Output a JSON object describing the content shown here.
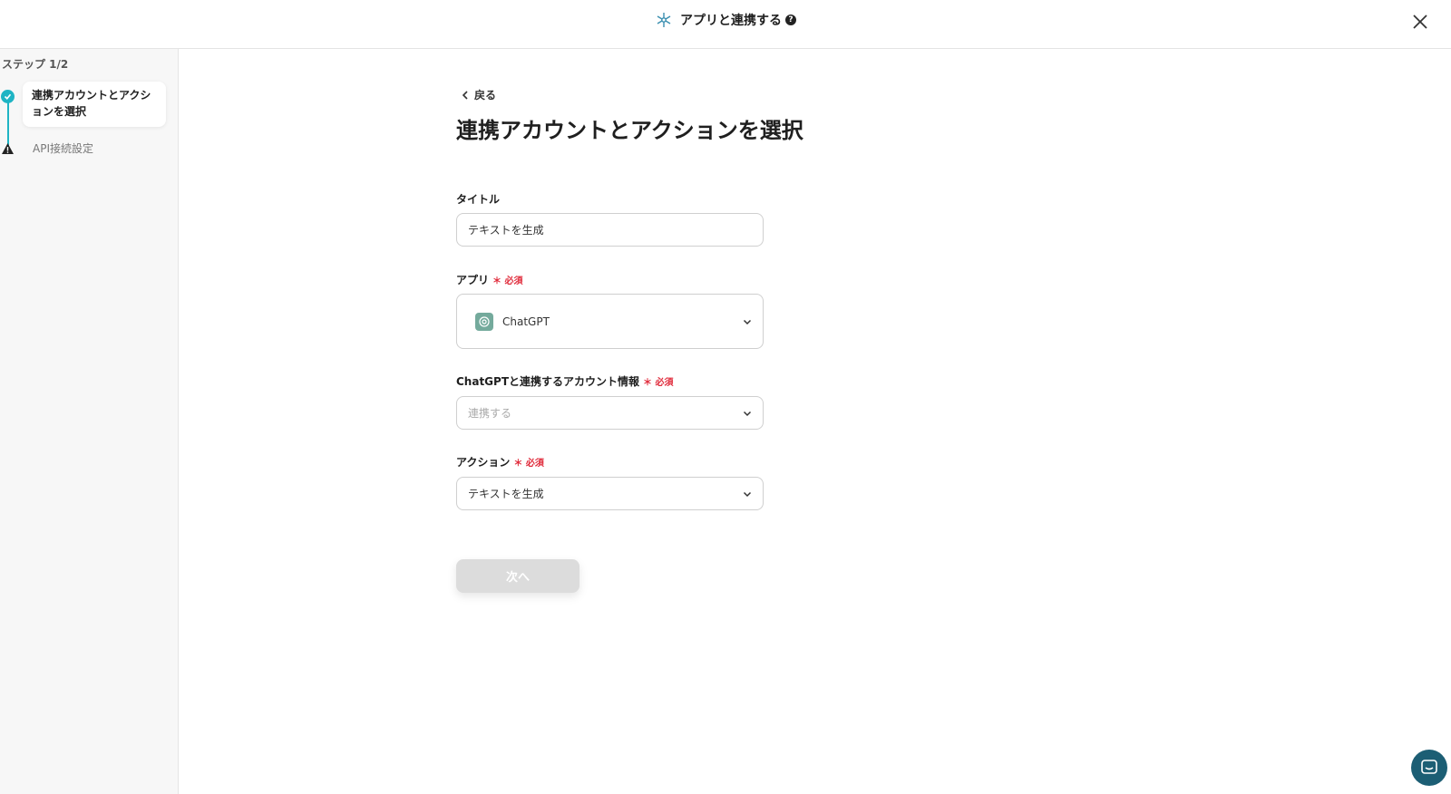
{
  "header": {
    "title": "アプリと連携する",
    "help_icon": "question-circle-icon",
    "help_text": "?"
  },
  "sidebar": {
    "step_count": "ステップ 1/2",
    "steps": [
      {
        "label": "連携アカウントとアクションを選択",
        "status": "active"
      },
      {
        "label": "API接続設定",
        "status": "warning"
      }
    ]
  },
  "main": {
    "back_label": "戻る",
    "page_title": "連携アカウントとアクションを選択",
    "title_field": {
      "label": "タイトル",
      "value": "テキストを生成"
    },
    "app_field": {
      "label": "アプリ",
      "required": "必須",
      "value": "ChatGPT"
    },
    "account_field": {
      "label": "ChatGPTと連携するアカウント情報",
      "required": "必須",
      "placeholder": "連携する"
    },
    "action_field": {
      "label": "アクション",
      "required": "必須",
      "value": "テキストを生成"
    },
    "next_button": "次へ"
  },
  "colors": {
    "accent": "#1fb4c4",
    "required": "#e02a3a",
    "chat": "#1c5e74"
  }
}
